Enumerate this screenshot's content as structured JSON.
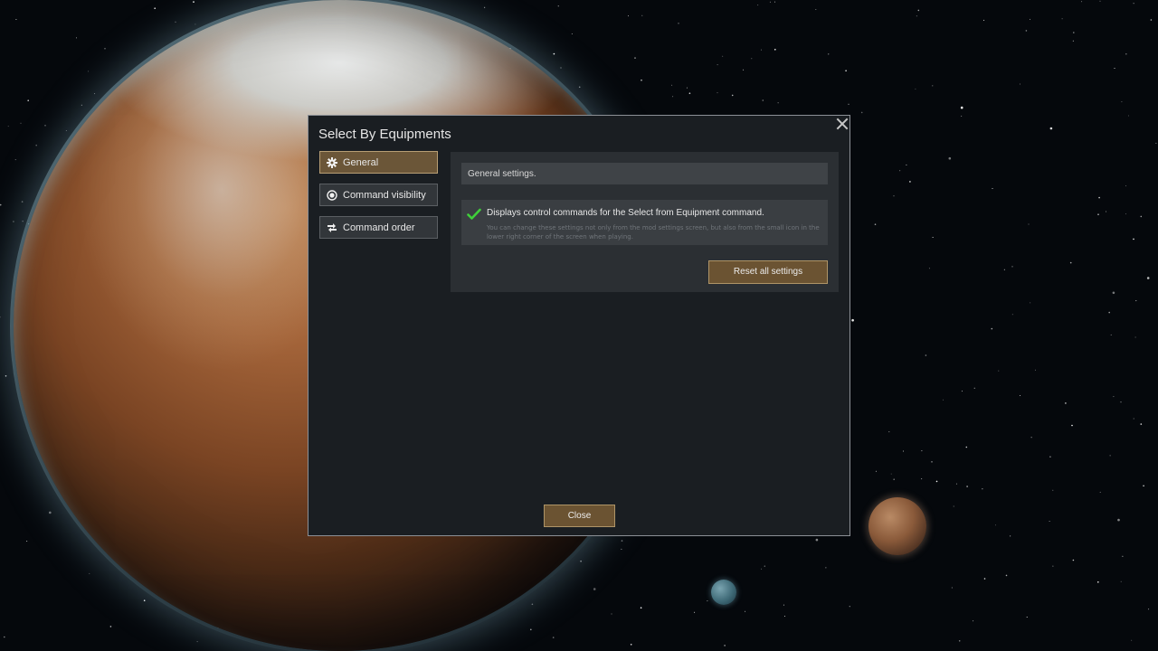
{
  "dialog": {
    "title": "Select By Equipments",
    "tabs": [
      {
        "label": "General",
        "icon": "gear-icon",
        "active": true
      },
      {
        "label": "Command visibility",
        "icon": "radio-target-icon",
        "active": false
      },
      {
        "label": "Command order",
        "icon": "reorder-arrows-icon",
        "active": false
      }
    ],
    "content": {
      "section_header": "General settings.",
      "setting": {
        "checked": true,
        "title": "Displays control commands for the Select from Equipment command.",
        "description": "You can change these settings not only from the mod settings screen, but also from the small icon in the lower right corner of the screen when playing."
      },
      "reset_button_label": "Reset all settings"
    },
    "close_button_label": "Close"
  },
  "colors": {
    "accent_gold": "#6b5332",
    "accent_gold_border": "#ae9467",
    "check_green": "#3fcf3a",
    "dialog_bg": "#1a1e22"
  }
}
